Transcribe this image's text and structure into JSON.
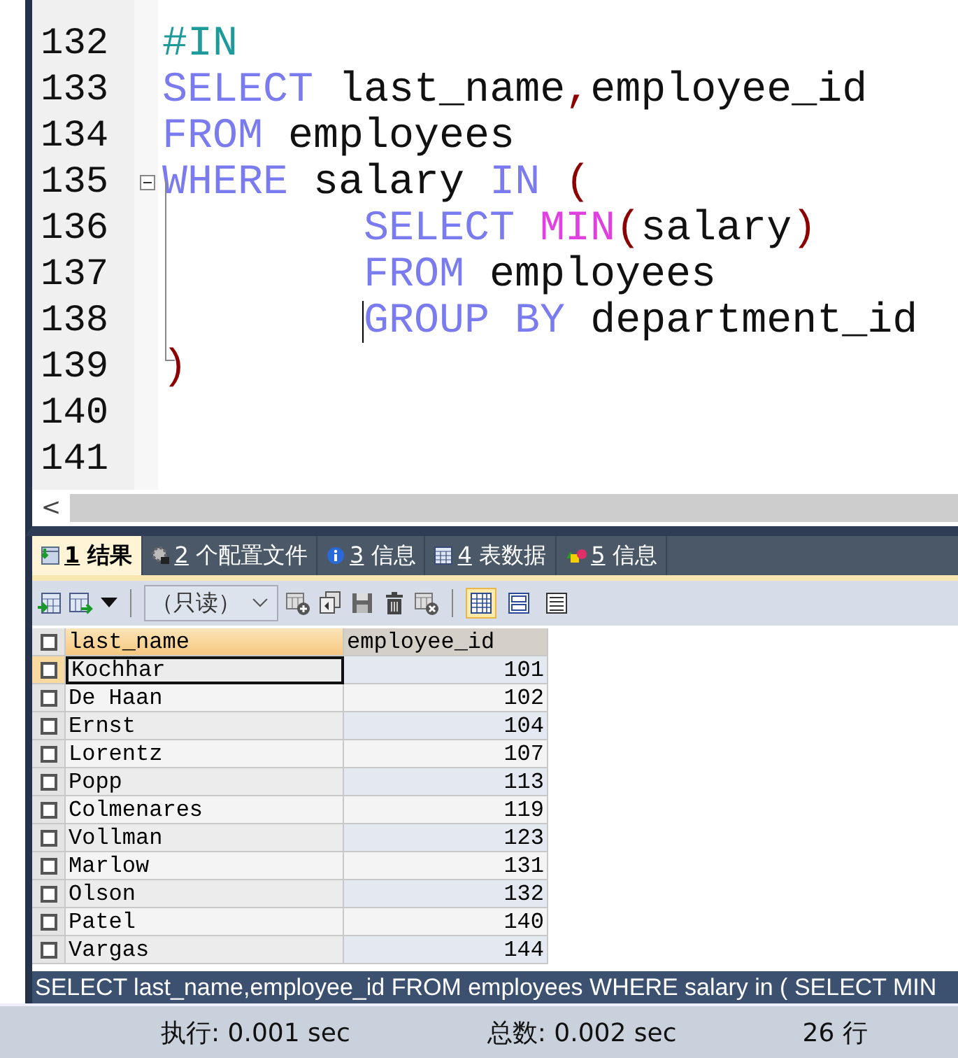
{
  "editor": {
    "lines": [
      {
        "number": "132",
        "indented": false,
        "fold": false,
        "cursor": false,
        "words": [
          [
            {
              "kind": "comment",
              "text": "#IN"
            }
          ]
        ]
      },
      {
        "number": "133",
        "indented": false,
        "fold": false,
        "cursor": false,
        "words": [
          [
            {
              "kind": "keyword",
              "text": "SELECT"
            }
          ],
          [
            {
              "kind": "plain",
              "text": "last_name"
            },
            {
              "kind": "punct",
              "text": ","
            },
            {
              "kind": "plain",
              "text": "employee_id"
            }
          ]
        ]
      },
      {
        "number": "134",
        "indented": false,
        "fold": false,
        "cursor": false,
        "words": [
          [
            {
              "kind": "keyword",
              "text": "FROM"
            }
          ],
          [
            {
              "kind": "plain",
              "text": "employees"
            }
          ]
        ]
      },
      {
        "number": "135",
        "indented": false,
        "fold": true,
        "cursor": false,
        "words": [
          [
            {
              "kind": "keyword",
              "text": "WHERE"
            }
          ],
          [
            {
              "kind": "plain",
              "text": "salary"
            }
          ],
          [
            {
              "kind": "keyword",
              "text": "IN"
            }
          ],
          [
            {
              "kind": "punct",
              "text": "("
            }
          ]
        ]
      },
      {
        "number": "136",
        "indented": true,
        "fold": false,
        "cursor": false,
        "words": [
          [
            {
              "kind": "keyword",
              "text": "SELECT"
            }
          ],
          [
            {
              "kind": "function",
              "text": "MIN"
            },
            {
              "kind": "punct",
              "text": "("
            },
            {
              "kind": "plain",
              "text": "salary"
            },
            {
              "kind": "punct",
              "text": ")"
            }
          ]
        ]
      },
      {
        "number": "137",
        "indented": true,
        "fold": false,
        "cursor": false,
        "words": [
          [
            {
              "kind": "keyword",
              "text": "FROM"
            }
          ],
          [
            {
              "kind": "plain",
              "text": "employees"
            }
          ]
        ]
      },
      {
        "number": "138",
        "indented": true,
        "fold": false,
        "cursor": true,
        "words": [
          [
            {
              "kind": "keyword",
              "text": "GROUP"
            }
          ],
          [
            {
              "kind": "keyword",
              "text": "BY"
            }
          ],
          [
            {
              "kind": "plain",
              "text": "department_id"
            }
          ]
        ]
      },
      {
        "number": "139",
        "indented": false,
        "fold": false,
        "cursor": false,
        "words": [
          [
            {
              "kind": "punct",
              "text": ")"
            }
          ]
        ]
      },
      {
        "number": "140",
        "fold": false,
        "cursor": false
      },
      {
        "number": "141",
        "fold": false,
        "cursor": false
      }
    ],
    "scroll_left": "<"
  },
  "tabs": [
    {
      "number": "1",
      "label": "结果",
      "selected": true
    },
    {
      "number": "2",
      "label": "个配置文件",
      "selected": false
    },
    {
      "number": "3",
      "label": "信息",
      "selected": false
    },
    {
      "number": "4",
      "label": "表数据",
      "selected": false
    },
    {
      "number": "5",
      "label": "信息",
      "selected": false
    }
  ],
  "toolbar": {
    "mode_dropdown": "（只读）",
    "view_modes": [
      {
        "selected": true
      },
      {
        "selected": false
      },
      {
        "selected": false
      }
    ]
  },
  "table": {
    "columns": [
      "last_name",
      "employee_id"
    ],
    "all_checked": false,
    "rows": [
      {
        "last_name": "Kochhar",
        "employee_id": "101",
        "checked": false,
        "selected": true
      },
      {
        "last_name": "De Haan",
        "employee_id": "102",
        "checked": false,
        "selected": false
      },
      {
        "last_name": "Ernst",
        "employee_id": "104",
        "checked": false,
        "selected": false
      },
      {
        "last_name": "Lorentz",
        "employee_id": "107",
        "checked": false,
        "selected": false
      },
      {
        "last_name": "Popp",
        "employee_id": "113",
        "checked": false,
        "selected": false
      },
      {
        "last_name": "Colmenares",
        "employee_id": "119",
        "checked": false,
        "selected": false
      },
      {
        "last_name": "Vollman",
        "employee_id": "123",
        "checked": false,
        "selected": false
      },
      {
        "last_name": "Marlow",
        "employee_id": "131",
        "checked": false,
        "selected": false
      },
      {
        "last_name": "Olson",
        "employee_id": "132",
        "checked": false,
        "selected": false
      },
      {
        "last_name": "Patel",
        "employee_id": "140",
        "checked": false,
        "selected": false
      },
      {
        "last_name": "Vargas",
        "employee_id": "144",
        "checked": false,
        "selected": false
      }
    ]
  },
  "query_bar": "SELECT last_name,employee_id FROM employees WHERE salary in ( SELECT MIN",
  "status_bar": {
    "execution": "执行: 0.001 sec",
    "total": "总数: 0.002 sec",
    "rows": "26 行"
  }
}
